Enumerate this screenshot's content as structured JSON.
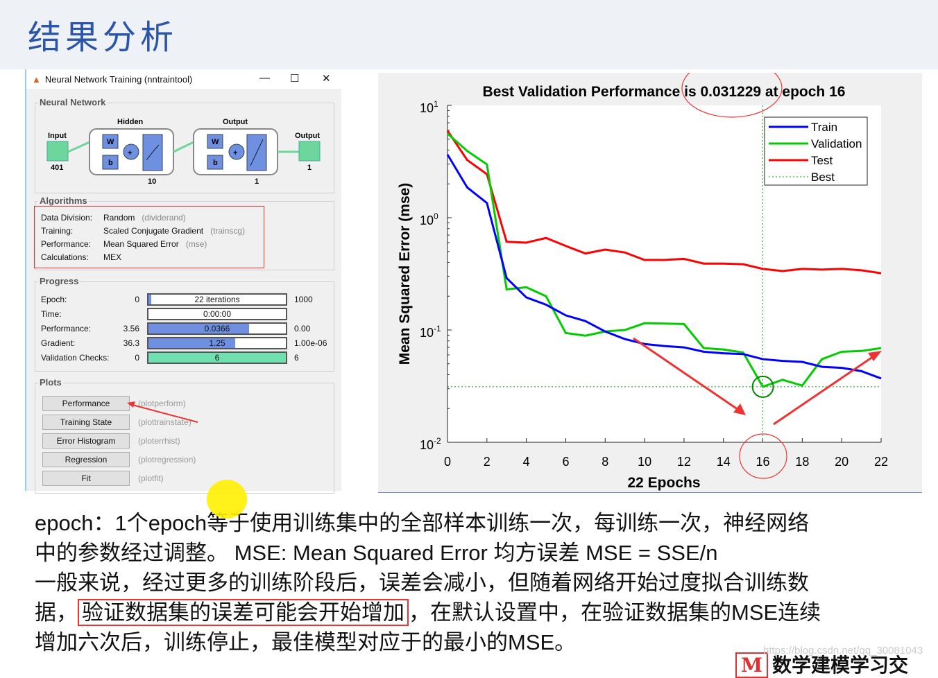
{
  "slide_title": "结果分析",
  "window": {
    "title": "Neural Network Training (nntraintool)",
    "minimize": "—",
    "maximize": "☐",
    "close": "✕",
    "network": {
      "section": "Neural Network",
      "hidden_label": "Hidden",
      "output_label": "Output",
      "input_label": "Input",
      "output_node_label": "Output",
      "input_size": "401",
      "hidden_size": "10",
      "output_layer_size": "1",
      "output_size": "1",
      "w": "W",
      "b": "b"
    },
    "algorithms": {
      "section": "Algorithms",
      "rows": [
        {
          "label": "Data Division:",
          "value": "Random",
          "fn": "(dividerand)"
        },
        {
          "label": "Training:",
          "value": "Scaled Conjugate Gradient",
          "fn": "(trainscg)"
        },
        {
          "label": "Performance:",
          "value": "Mean Squared Error",
          "fn": "(mse)"
        },
        {
          "label": "Calculations:",
          "value": "MEX",
          "fn": ""
        }
      ]
    },
    "progress": {
      "section": "Progress",
      "rows": [
        {
          "label": "Epoch:",
          "start": "0",
          "text": "22 iterations",
          "end": "1000",
          "fill": 0.022,
          "color": "#6f8fe0"
        },
        {
          "label": "Time:",
          "start": "",
          "text": "0:00:00",
          "end": "",
          "fill": 0,
          "color": "#6f8fe0"
        },
        {
          "label": "Performance:",
          "start": "3.56",
          "text": "0.0366",
          "end": "0.00",
          "fill": 0.73,
          "color": "#6f8fe0"
        },
        {
          "label": "Gradient:",
          "start": "36.3",
          "text": "1.25",
          "end": "1.00e-06",
          "fill": 0.63,
          "color": "#6f8fe0"
        },
        {
          "label": "Validation Checks:",
          "start": "0",
          "text": "6",
          "end": "6",
          "fill": 1.0,
          "color": "#6fe0b0"
        }
      ]
    },
    "plots": {
      "section": "Plots",
      "buttons": [
        {
          "label": "Performance",
          "fn": "(plotperform)"
        },
        {
          "label": "Training State",
          "fn": "(plottrainstate)"
        },
        {
          "label": "Error Histogram",
          "fn": "(ploterrhist)"
        },
        {
          "label": "Regression",
          "fn": "(plotregression)"
        },
        {
          "label": "Fit",
          "fn": "(plotfit)"
        }
      ]
    }
  },
  "chart_data": {
    "type": "line",
    "title": "Best Validation Performance is 0.031229 at epoch 16",
    "xlabel": "22 Epochs",
    "ylabel": "Mean Squared Error  (mse)",
    "yscale": "log",
    "xlim": [
      0,
      22
    ],
    "ylim": [
      0.01,
      10
    ],
    "xticks": [
      0,
      2,
      4,
      6,
      8,
      10,
      12,
      14,
      16,
      18,
      20,
      22
    ],
    "yticks": [
      {
        "base": "10",
        "exp": "-2",
        "v": 0.01
      },
      {
        "base": "10",
        "exp": "-1",
        "v": 0.1
      },
      {
        "base": "10",
        "exp": "0",
        "v": 1
      },
      {
        "base": "10",
        "exp": "1",
        "v": 10
      }
    ],
    "legend_position": "top-right",
    "grid": false,
    "series": [
      {
        "name": "Train",
        "color": "#0000ff",
        "values": [
          3.65,
          1.86,
          1.35,
          0.29,
          0.195,
          0.168,
          0.135,
          0.12,
          0.097,
          0.083,
          0.075,
          0.072,
          0.07,
          0.064,
          0.062,
          0.061,
          0.055,
          0.053,
          0.052,
          0.047,
          0.046,
          0.043,
          0.037
        ]
      },
      {
        "name": "Validation",
        "color": "#00cc00",
        "values": [
          5.6,
          3.93,
          2.98,
          0.23,
          0.24,
          0.2,
          0.094,
          0.089,
          0.097,
          0.1,
          0.115,
          0.114,
          0.113,
          0.069,
          0.067,
          0.063,
          0.031229,
          0.036,
          0.032,
          0.055,
          0.064,
          0.065,
          0.069
        ]
      },
      {
        "name": "Test",
        "color": "#ff0000",
        "values": [
          5.96,
          3.26,
          2.44,
          0.61,
          0.6,
          0.66,
          0.56,
          0.48,
          0.52,
          0.49,
          0.42,
          0.42,
          0.43,
          0.39,
          0.39,
          0.385,
          0.35,
          0.335,
          0.35,
          0.345,
          0.35,
          0.34,
          0.32
        ]
      }
    ],
    "best": {
      "name": "Best",
      "epoch": 16,
      "value": 0.031229,
      "color": "#00aa00"
    }
  },
  "paragraph": {
    "l1": "epoch：1个epoch等于使用训练集中的全部样本训练一次，每训练一次，神经网络",
    "l2": "中的参数经过调整。 MSE: Mean Squared Error   均方误差   MSE = SSE/n",
    "l3": "一般来说，经过更多的训练阶段后，误差会减小，但随着网络开始过度拟合训练数",
    "l4a": "据，",
    "l4b": "验证数据集的误差可能会开始增加",
    "l4c": "，在默认设置中，在验证数据集的MSE连续",
    "l5": "增加六次后，训练停止，最佳模型对应于的最小的MSE。"
  },
  "watermark": "https://blog.csdn.net/qq_30081043",
  "logo": "数学建模学习交"
}
